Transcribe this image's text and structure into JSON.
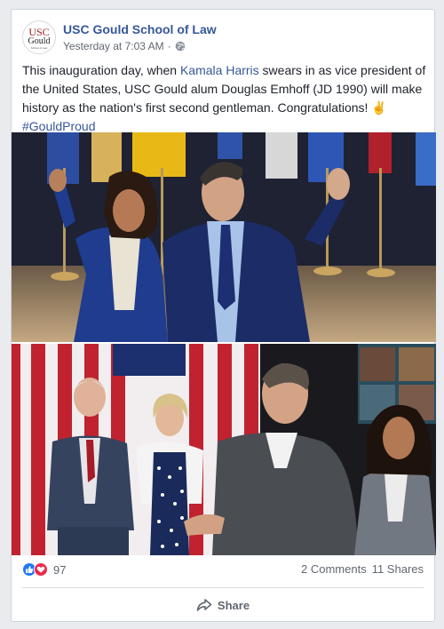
{
  "post": {
    "page_name": "USC Gould School of Law",
    "timestamp": "Yesterday at 7:03 AM",
    "separator": "·",
    "avatar": {
      "line1": "USC",
      "line2": "Gould",
      "line3": "School of Law"
    },
    "text_part1": "This inauguration day, when ",
    "text_link": "Kamala Harris",
    "text_part2": " swears in as vice president of the United States, USC Gould alum Douglas Emhoff (JD 1990) will make history as the nation's first second gentleman. Congratulations! ",
    "emoji": "✌",
    "hashtag": "#GouldProud"
  },
  "footer": {
    "reaction_count": "97",
    "comments": "2 Comments",
    "shares": "11 Shares",
    "share_label": "Share"
  },
  "colors": {
    "link": "#365899",
    "like": "#2078f4",
    "love": "#f0284a"
  }
}
